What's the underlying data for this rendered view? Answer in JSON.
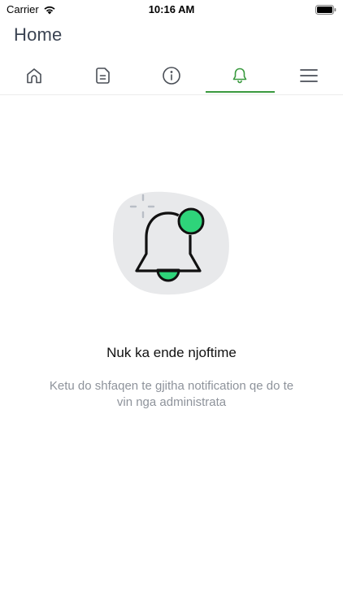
{
  "status_bar": {
    "carrier": "Carrier",
    "time": "10:16 AM"
  },
  "header": {
    "title": "Home"
  },
  "tabs": [
    {
      "name": "home-icon",
      "active": false
    },
    {
      "name": "document-icon",
      "active": false
    },
    {
      "name": "info-icon",
      "active": false
    },
    {
      "name": "bell-icon",
      "active": true
    },
    {
      "name": "menu-icon",
      "active": false
    }
  ],
  "empty_state": {
    "illustration": "bell-notification-illustration",
    "title": "Nuk ka ende njoftime",
    "message": "Ketu do shfaqen te gjitha notification qe do te vin nga administrata"
  },
  "colors": {
    "accent": "#3a9a3f",
    "title": "#3b4453",
    "icon_inactive": "#4a4f57",
    "notification_dot": "#2ed47a",
    "message": "#8e939b"
  }
}
